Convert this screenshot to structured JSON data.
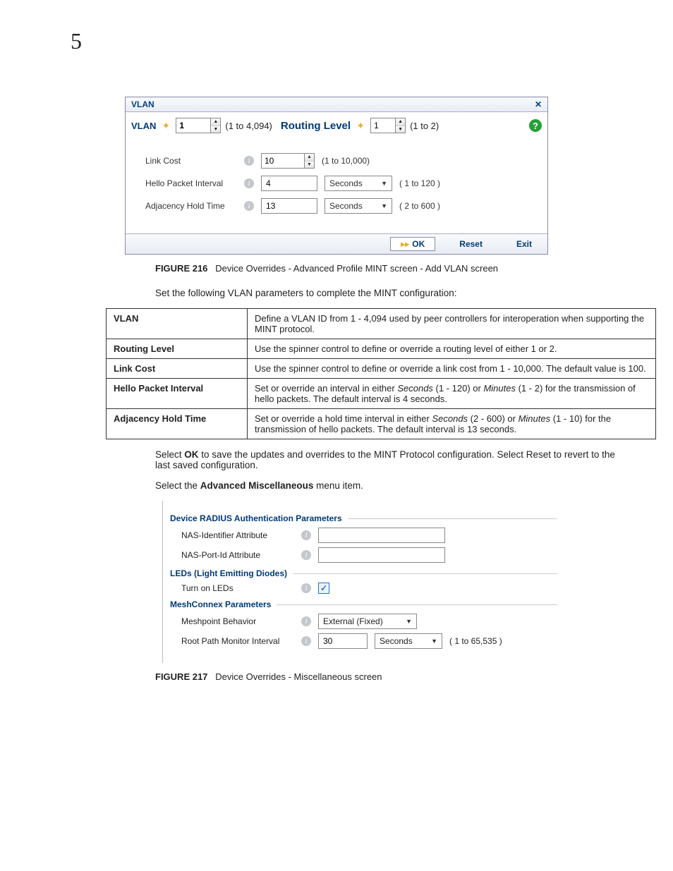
{
  "page_number": "5",
  "vlan_dialog": {
    "title": "VLAN",
    "vlan_label": "VLAN",
    "vlan_value": "1",
    "vlan_range": "(1 to 4,094)",
    "routing_label": "Routing Level",
    "routing_value": "1",
    "routing_range": "(1 to 2)",
    "rows": {
      "link_cost_label": "Link Cost",
      "link_cost_value": "10",
      "link_cost_range": "(1 to 10,000)",
      "hello_label": "Hello Packet Interval",
      "hello_value": "4",
      "hello_unit": "Seconds",
      "hello_range": "( 1 to 120 )",
      "adj_label": "Adjacency Hold Time",
      "adj_value": "13",
      "adj_unit": "Seconds",
      "adj_range": "( 2 to 600 )"
    },
    "ok_label": "OK",
    "reset_label": "Reset",
    "exit_label": "Exit"
  },
  "figure216": {
    "num": "FIGURE 216",
    "caption": "Device Overrides - Advanced Profile MINT screen - Add VLAN screen"
  },
  "body1": "Set the following VLAN parameters to complete the MINT configuration:",
  "table": {
    "r1k": "VLAN",
    "r1v": "Define a VLAN ID from 1 - 4,094 used by peer controllers for interoperation when supporting the MINT protocol.",
    "r2k": "Routing Level",
    "r2v": "Use the spinner control to define or override a routing level of either 1 or 2.",
    "r3k": "Link Cost",
    "r3v": "Use the spinner control to define or override a link cost from 1 - 10,000. The default value is 100.",
    "r4k": "Hello Packet Interval",
    "r4v_a": "Set or override an interval in either ",
    "r4v_b": "Seconds",
    "r4v_c": " (1 - 120) or ",
    "r4v_d": "Minutes",
    "r4v_e": " (1 - 2) for the transmission of hello packets. The default interval is 4 seconds.",
    "r5k": "Adjacency Hold Time",
    "r5v_a": "Set or override a hold time interval in either ",
    "r5v_b": "Seconds",
    "r5v_c": " (2 - 600) or ",
    "r5v_d": "Minutes",
    "r5v_e": " (1 - 10) for the transmission of hello packets. The default interval is 13 seconds."
  },
  "body2_a": "Select ",
  "body2_b": "OK",
  "body2_c": " to save the updates and overrides to the MINT Protocol configuration. Select Reset to revert to the last saved configuration.",
  "body3_a": "Select the ",
  "body3_b": "Advanced Miscellaneous",
  "body3_c": " menu item.",
  "misc": {
    "section1": "Device RADIUS Authentication Parameters",
    "nas_id_label": "NAS-Identifier Attribute",
    "nas_port_label": "NAS-Port-Id Attribute",
    "section2": "LEDs (Light Emitting Diodes)",
    "leds_label": "Turn on LEDs",
    "section3": "MeshConnex Parameters",
    "meshpoint_label": "Meshpoint Behavior",
    "meshpoint_value": "External (Fixed)",
    "rootpath_label": "Root Path Monitor Interval",
    "rootpath_value": "30",
    "rootpath_unit": "Seconds",
    "rootpath_range": "( 1 to 65,535 )"
  },
  "figure217": {
    "num": "FIGURE 217",
    "caption": "Device Overrides - Miscellaneous screen"
  }
}
